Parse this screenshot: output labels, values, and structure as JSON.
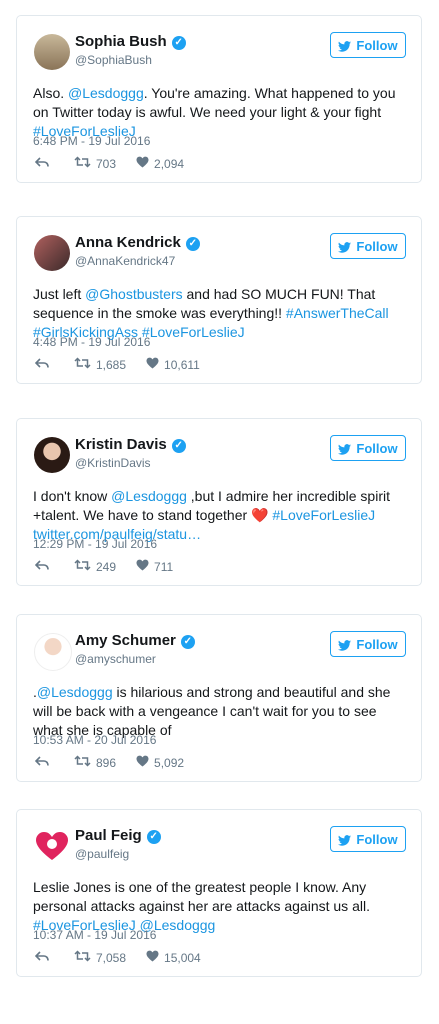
{
  "follow_label": "Follow",
  "tweets": [
    {
      "name": "Sophia Bush",
      "handle": "@SophiaBush",
      "segments": [
        {
          "t": "Also. ",
          "link": false
        },
        {
          "t": "@Lesdoggg",
          "link": true
        },
        {
          "t": ". You're amazing. What happened to you on Twitter today is awful. We need your light & your fight ",
          "link": false
        },
        {
          "t": "#LoveForLeslieJ",
          "link": true
        }
      ],
      "time": "6:48 PM - 19 Jul 2016",
      "retweets": "703",
      "likes": "2,094"
    },
    {
      "name": "Anna Kendrick",
      "handle": "@AnnaKendrick47",
      "segments": [
        {
          "t": "Just left ",
          "link": false
        },
        {
          "t": "@Ghostbusters",
          "link": true
        },
        {
          "t": " and had SO MUCH FUN! That sequence in the smoke was everything!! ",
          "link": false
        },
        {
          "t": "#AnswerTheCall",
          "link": true
        },
        {
          "t": " ",
          "link": false
        },
        {
          "t": "#GirlsKickingAss",
          "link": true
        },
        {
          "t": " ",
          "link": false
        },
        {
          "t": "#LoveForLeslieJ",
          "link": true
        }
      ],
      "time": "4:48 PM - 19 Jul 2016",
      "retweets": "1,685",
      "likes": "10,611"
    },
    {
      "name": "Kristin Davis",
      "handle": "@KristinDavis",
      "segments": [
        {
          "t": "I don't know ",
          "link": false
        },
        {
          "t": "@Lesdoggg",
          "link": true
        },
        {
          "t": " ,but I admire her incredible spirit +talent. We have to stand together ",
          "link": false
        },
        {
          "t": "❤️",
          "link": false,
          "heart": true
        },
        {
          "t": " ",
          "link": false
        },
        {
          "t": "#LoveForLeslieJ",
          "link": true
        },
        {
          "t": " ",
          "link": false
        },
        {
          "t": "twitter.com/paulfeig/statu…",
          "link": true
        }
      ],
      "time": "12:29 PM - 19 Jul 2016",
      "retweets": "249",
      "likes": "711"
    },
    {
      "name": "Amy Schumer",
      "handle": "@amyschumer",
      "segments": [
        {
          "t": ".",
          "link": false
        },
        {
          "t": "@Lesdoggg",
          "link": true
        },
        {
          "t": " is hilarious and strong and beautiful and she will be back with a vengeance I can't wait for you to see what she is capable of",
          "link": false
        }
      ],
      "time": "10:53 AM - 20 Jul 2016",
      "retweets": "896",
      "likes": "5,092"
    },
    {
      "name": "Paul Feig",
      "handle": "@paulfeig",
      "segments": [
        {
          "t": "Leslie Jones is one of the greatest people I know. Any personal attacks against her are attacks against us all. ",
          "link": false
        },
        {
          "t": "#LoveForLeslieJ",
          "link": true
        },
        {
          "t": " ",
          "link": false
        },
        {
          "t": "@Lesdoggg",
          "link": true
        }
      ],
      "time": "10:37 AM - 19 Jul 2016",
      "retweets": "7,058",
      "likes": "15,004"
    }
  ],
  "icons": {
    "reply": "reply-icon",
    "retweet": "retweet-icon",
    "like": "heart-icon",
    "bird": "twitter-bird-icon",
    "verified": "verified-badge-icon"
  },
  "colors": {
    "accent": "#1da1f2",
    "link": "#1b95e0",
    "meta": "#657786",
    "border": "#e1e8ed",
    "heart": "#e0245e"
  }
}
